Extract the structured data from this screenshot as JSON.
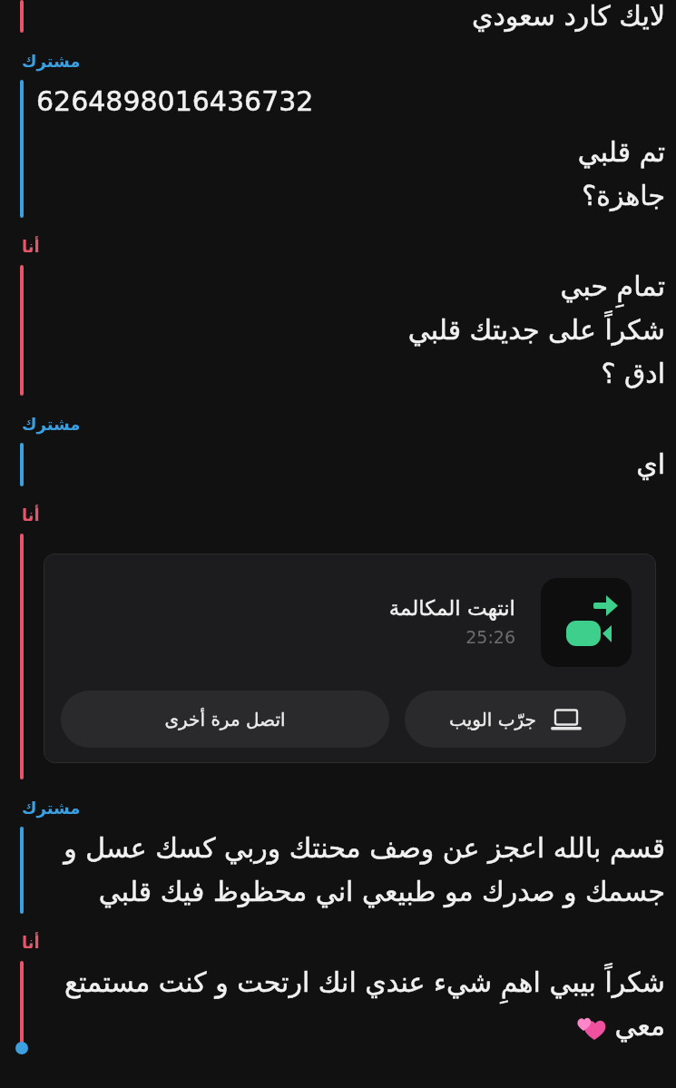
{
  "messages": [
    {
      "color": "#e5566a",
      "paragraphs": [
        {
          "text": "لايك كارد سعودي",
          "trailing_icon": false
        }
      ]
    },
    {
      "sender": "مشترك",
      "color": "#3b9fe0",
      "paragraphs": [
        {
          "text": "6264898016436732",
          "trailing_icon": false
        },
        {
          "text": "تم قلبي\nجاهزة؟",
          "trailing_icon": false
        }
      ]
    },
    {
      "sender": "أنا",
      "color": "#e5566a",
      "paragraphs": [
        {
          "text": "تمامِ حبي\nشكراً على جديتك قلبي\nادق ؟",
          "trailing_icon": false
        }
      ]
    },
    {
      "sender": "مشترك",
      "color": "#3b9fe0",
      "paragraphs": [
        {
          "text": "اي",
          "trailing_icon": false
        }
      ]
    },
    {
      "sender": "أنا",
      "color": "#e5566a",
      "call": {
        "title": "انتهت المكالمة",
        "duration": "25:26",
        "buttons": [
          {
            "label": "جرّب الويب",
            "kind": "icon"
          },
          {
            "label": "اتصل مرة أخرى",
            "kind": "text"
          }
        ]
      }
    },
    {
      "sender": "مشترك",
      "color": "#3b9fe0",
      "paragraphs": [
        {
          "text": "قسم بالله اعجز عن وصف محنتك وربي كسك عسل و جسمك و صدرك مو طبيعي اني محظوظ فيك قلبي",
          "trailing_icon": false
        }
      ]
    },
    {
      "sender": "أنا",
      "color": "#e5566a",
      "paragraphs": [
        {
          "text": "شكراً بيبي اهمِ شيء عندي انك ارتحت و كنت مستمتع معي",
          "trailing_icon": true
        }
      ]
    }
  ]
}
